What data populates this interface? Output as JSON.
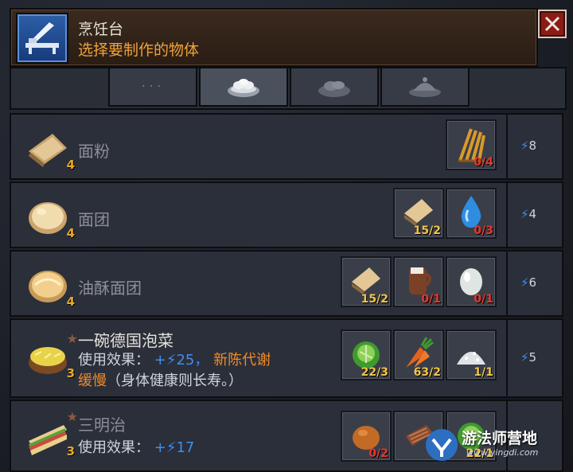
{
  "window": {
    "title": "烹饪台",
    "subtitle": "选择要制作的物体",
    "close_icon": "close-icon"
  },
  "tabs": [
    {
      "name": "more",
      "label": "···",
      "icon": "dots-icon",
      "active": false
    },
    {
      "name": "bread-plate",
      "icon": "bread-plate-icon",
      "active": true
    },
    {
      "name": "meat-plate",
      "icon": "meat-plate-icon",
      "active": false
    },
    {
      "name": "dome-plate",
      "icon": "dome-plate-icon",
      "active": false
    }
  ],
  "recipes": [
    {
      "name": "面粉",
      "qty": "4",
      "icon": "flour-icon",
      "energy": "8",
      "ingredients": [
        {
          "icon": "wheat-icon",
          "count": "0/4",
          "status": "low"
        }
      ]
    },
    {
      "name": "面团",
      "qty": "4",
      "icon": "dough-icon",
      "energy": "4",
      "ingredients": [
        {
          "icon": "flour-icon",
          "count": "15/2",
          "status": "ok"
        },
        {
          "icon": "water-icon",
          "count": "0/3",
          "status": "low"
        }
      ]
    },
    {
      "name": "油酥面团",
      "qty": "4",
      "icon": "pastry-dough-icon",
      "energy": "6",
      "ingredients": [
        {
          "icon": "flour-icon",
          "count": "15/2",
          "status": "ok"
        },
        {
          "icon": "milk-jug-icon",
          "count": "0/1",
          "status": "low"
        },
        {
          "icon": "egg-icon",
          "count": "0/1",
          "status": "low"
        }
      ]
    },
    {
      "name": "一碗德国泡菜",
      "qty": "3",
      "icon": "sauerkraut-bowl-icon",
      "energy": "5",
      "effect_label": "使用效果：",
      "effect_value": "+⚡25，",
      "effect_extra": "新陈代谢",
      "effect_line2_orange": "缓慢",
      "effect_line2_rest": "（身体健康则长寿。）",
      "ingredients": [
        {
          "icon": "cabbage-icon",
          "count": "22/3",
          "status": "ok"
        },
        {
          "icon": "carrot-icon",
          "count": "63/2",
          "status": "ok"
        },
        {
          "icon": "salt-icon",
          "count": "1/1",
          "status": "ok"
        }
      ]
    },
    {
      "name": "三明治",
      "qty": "3",
      "icon": "sandwich-icon",
      "energy": "",
      "effect_label": "使用效果：",
      "effect_value": "+⚡17",
      "ingredients": [
        {
          "icon": "bread-icon",
          "count": "0/2",
          "status": "low"
        },
        {
          "icon": "meat-icon",
          "count": "0",
          "status": "low"
        },
        {
          "icon": "cabbage-icon",
          "count": "22/1",
          "status": "ok"
        }
      ]
    }
  ],
  "watermark": {
    "text": "游法师营地",
    "url": "www.yingdi.com"
  },
  "colors": {
    "accent_orange": "#f08a2a",
    "energy_blue": "#3f8ef0",
    "count_low": "#e8382d",
    "count_ok": "#f0c649"
  }
}
